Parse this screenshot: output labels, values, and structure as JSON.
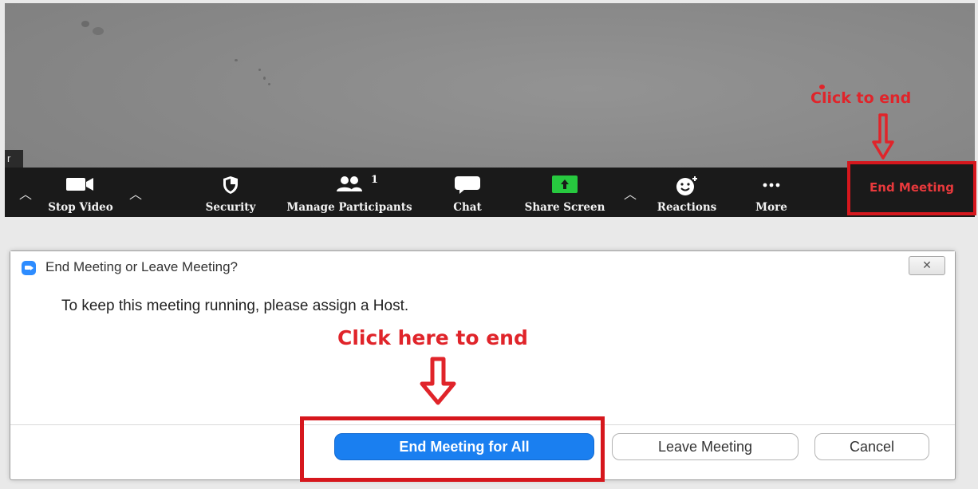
{
  "meeting": {
    "participant_name_fragment": "r",
    "annotation": "Click to end",
    "toolbar": {
      "stop_video": "Stop Video",
      "security": "Security",
      "manage_participants": "Manage Participants",
      "participant_count": "1",
      "chat": "Chat",
      "share_screen": "Share Screen",
      "reactions": "Reactions",
      "more": "More",
      "end_meeting": "End Meeting"
    }
  },
  "dialog": {
    "title": "End Meeting or Leave Meeting?",
    "close_symbol": "✕",
    "message": "To keep this meeting running, please assign a Host.",
    "annotation": "Click here to end",
    "buttons": {
      "end_for_all": "End Meeting for All",
      "leave": "Leave Meeting",
      "cancel": "Cancel"
    }
  },
  "colors": {
    "annotation_red": "#e0242a",
    "zoom_blue": "#1a7ff0",
    "share_green": "#27c93f",
    "toolbar_bg": "#1a1a1a"
  }
}
